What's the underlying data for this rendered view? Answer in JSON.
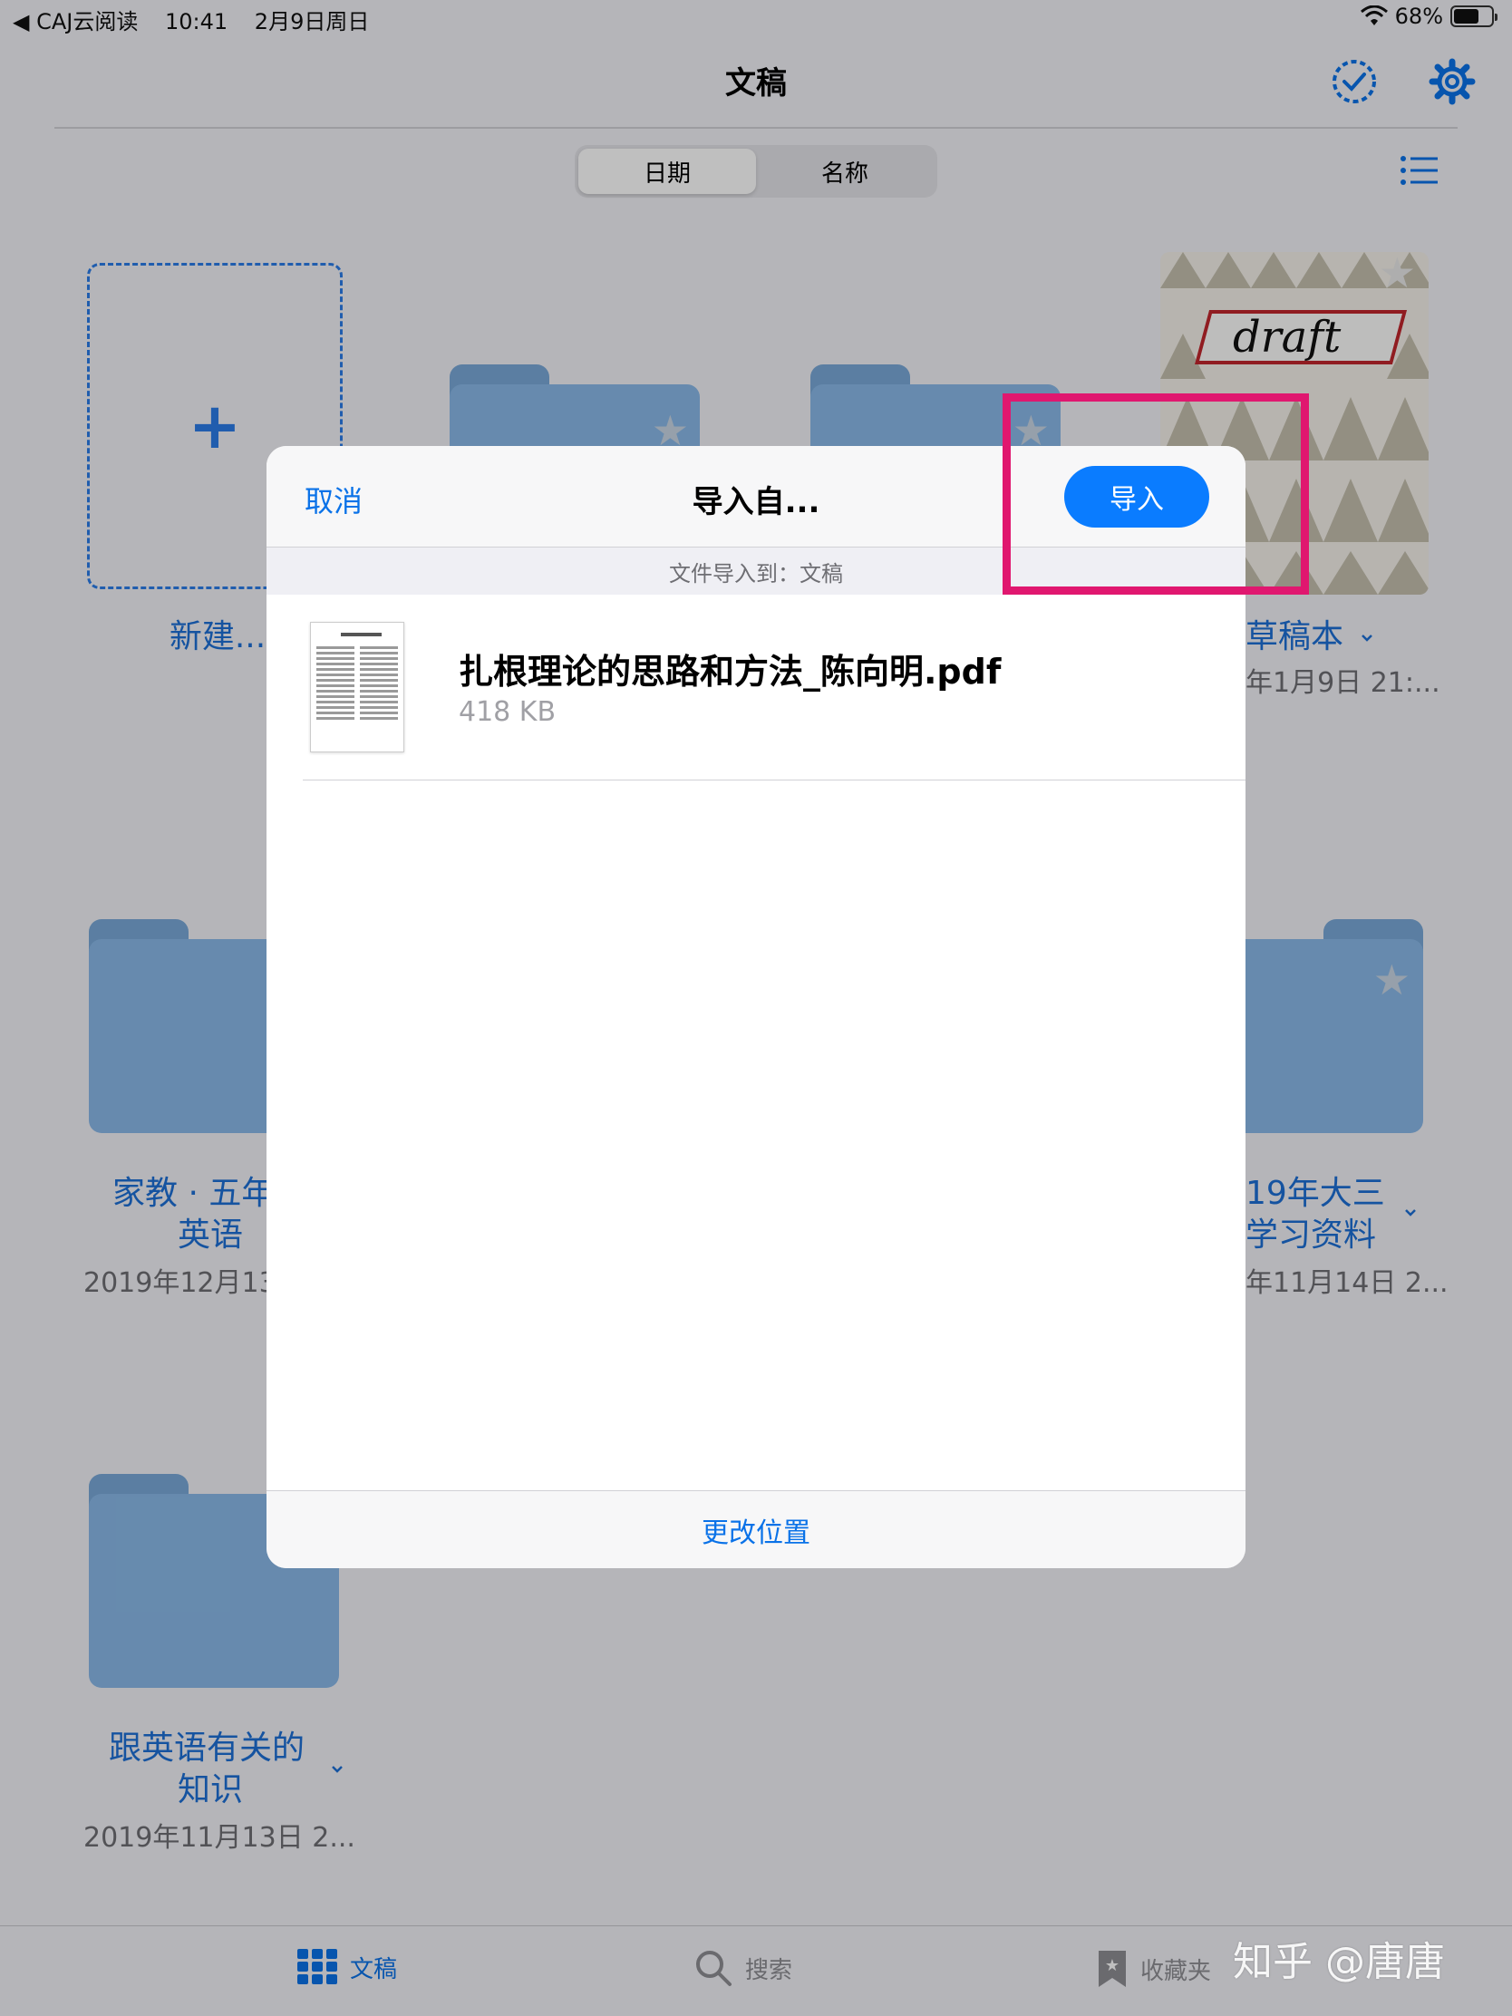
{
  "status_bar": {
    "back_app": "◀ CAJ云阅读",
    "time": "10:41",
    "date": "2月9日周日",
    "battery": "68%"
  },
  "nav": {
    "title": "文稿"
  },
  "sort": {
    "options": [
      "日期",
      "名称"
    ],
    "selected": "日期"
  },
  "grid": {
    "new_label": "新建...",
    "draft": {
      "cover_text": "draft",
      "name": "草稿本",
      "date": "年1月9日 21:..."
    },
    "folder_a": {
      "name_line1": "家教 · 五年",
      "name_line2": "英语",
      "date": "2019年12月13"
    },
    "folder_b": {
      "name_line1": "19年大三",
      "name_line2": "学习资料",
      "date": "年11月14日 2..."
    },
    "folder_c": {
      "name_line1": "跟英语有关的",
      "name_line2": "知识",
      "date": "2019年11月13日 2..."
    }
  },
  "modal": {
    "cancel_label": "取消",
    "title": "导入自...",
    "import_label": "导入",
    "subtitle": "文件导入到：文稿",
    "file": {
      "name": "扎根理论的思路和方法_陈向明.pdf",
      "size": "418 KB"
    },
    "footer_label": "更改位置"
  },
  "tabs": [
    {
      "label": "文稿",
      "icon": "grid-icon",
      "active": true
    },
    {
      "label": "搜索",
      "icon": "search-icon",
      "active": false
    },
    {
      "label": "收藏夹",
      "icon": "bookmark-icon",
      "active": false
    }
  ],
  "watermark": "知乎 @唐唐",
  "colors": {
    "accent": "#0a7cff",
    "highlight": "#e0176f",
    "folder": "#8ab9e8"
  }
}
